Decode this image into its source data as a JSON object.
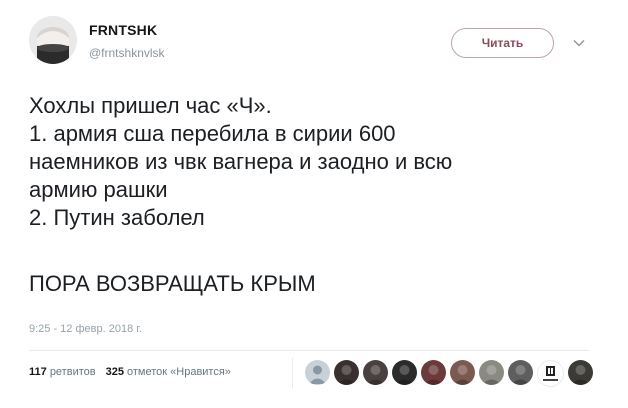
{
  "author": {
    "name": "FRNTSHK",
    "handle": "@frntshknvlsk"
  },
  "follow_button": {
    "label": "Читать"
  },
  "tweet": {
    "lines": [
      "Хохлы пришел час «Ч».",
      "1. армия сша перебила в сирии 600",
      "наемников из чвк вагнера и заодно и всю",
      "армию рашки",
      "2. Путин заболел",
      "",
      "ПОРА ВОЗВРАЩАТЬ КРЫМ"
    ]
  },
  "timestamp": "9:25 - 12 февр. 2018 г.",
  "stats": {
    "retweets_count": "117",
    "retweets_label": "ретвитов",
    "likes_count": "325",
    "likes_label": "отметок «Нравится»"
  },
  "likers": [
    {
      "icon": "default-avatar-icon",
      "bg": "#c9d1d8"
    },
    {
      "icon": "avatar-dark-icon",
      "bg": "#3a3030"
    },
    {
      "icon": "avatar-car-icon",
      "bg": "#4a4040"
    },
    {
      "icon": "avatar-dark-icon",
      "bg": "#2b2b2b"
    },
    {
      "icon": "avatar-person-icon",
      "bg": "#6b3a3a"
    },
    {
      "icon": "avatar-person-icon",
      "bg": "#7a5a50"
    },
    {
      "icon": "avatar-animal-icon",
      "bg": "#8a8a80"
    },
    {
      "icon": "avatar-gray-icon",
      "bg": "#5e5e5e"
    },
    {
      "icon": "avatar-logo-icon",
      "bg": "#ffffff"
    },
    {
      "icon": "avatar-person-icon",
      "bg": "#3c3a35"
    }
  ]
}
